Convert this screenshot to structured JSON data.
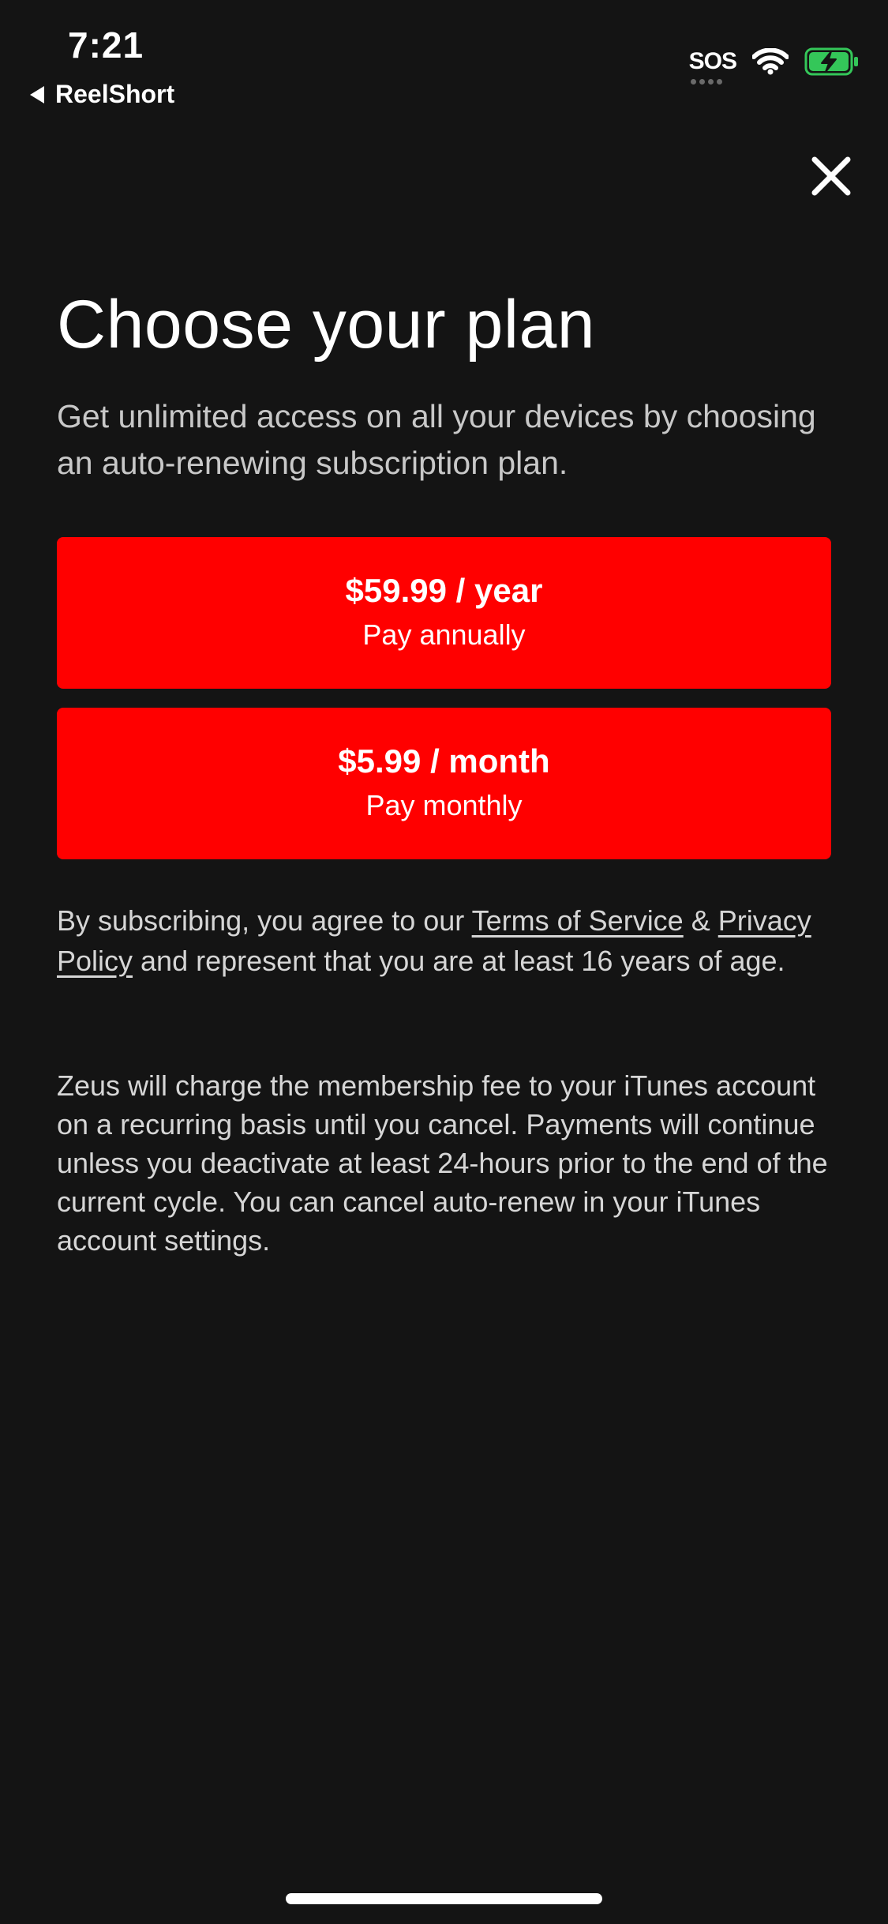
{
  "status_bar": {
    "time": "7:21",
    "back_app": "ReelShort",
    "sos": "SOS",
    "icons": [
      "wifi-icon",
      "battery-charging-icon"
    ],
    "battery_color": "#34c759"
  },
  "modal": {
    "title": "Choose your plan",
    "subtitle": "Get unlimited access on all your devices by choosing an auto-renewing subscription plan.",
    "close_icon": "close-icon",
    "accent_color": "#ff0000",
    "plans": [
      {
        "price": "$59.99 / year",
        "period": "Pay annually"
      },
      {
        "price": "$5.99 / month",
        "period": "Pay monthly"
      }
    ],
    "legal": {
      "prefix": "By subscribing, you agree to our ",
      "terms_link": "Terms of Service",
      "ampersand": " & ",
      "privacy_link": "Privacy Policy",
      "suffix": " and represent that you are at least 16 years of age."
    },
    "billing_notice": "Zeus will charge the membership fee to your iTunes account on a recurring basis until you cancel. Payments will continue unless you deactivate at least 24-hours prior to the end of the current cycle. You can cancel auto-renew in your iTunes account settings."
  }
}
